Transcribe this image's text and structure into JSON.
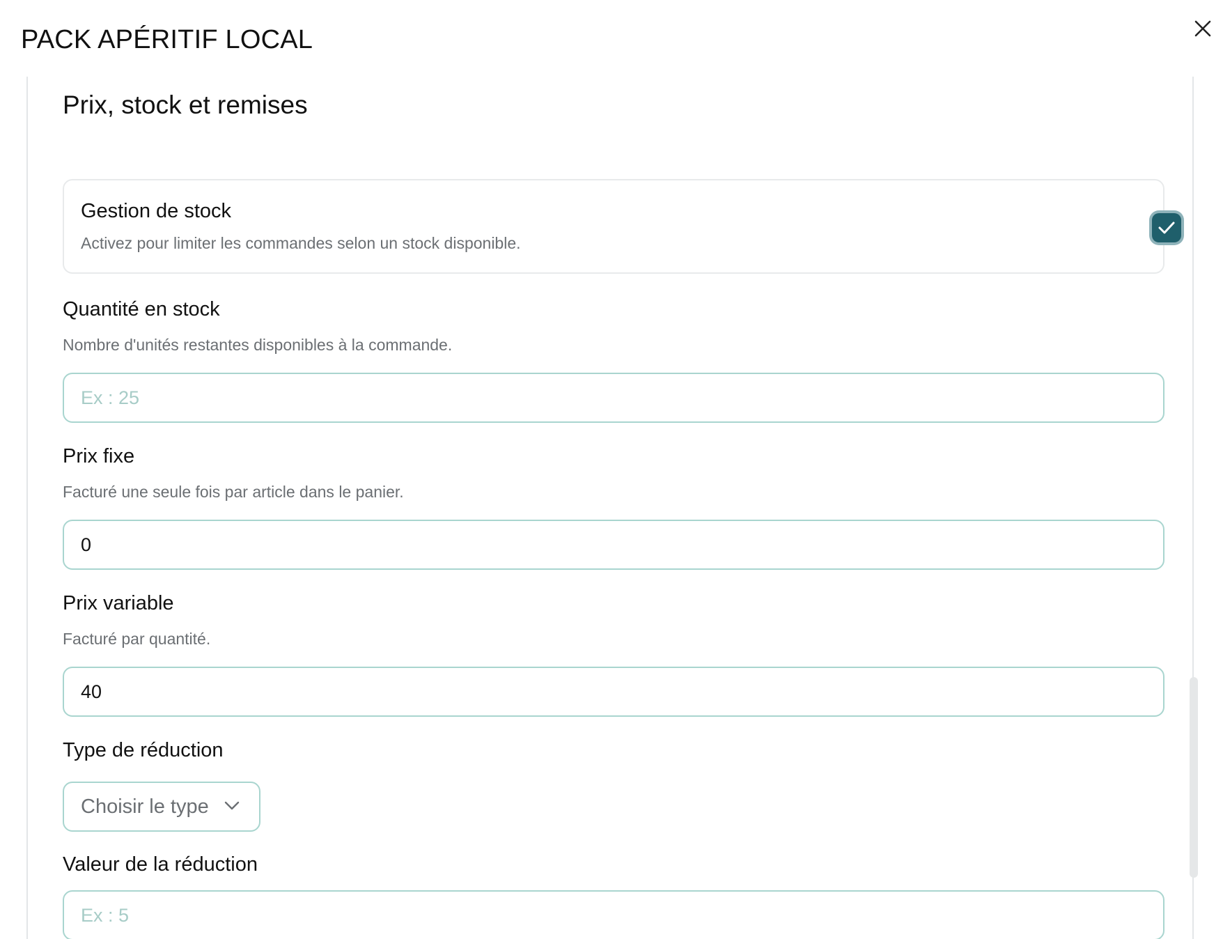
{
  "modal": {
    "title": "PACK APÉRITIF LOCAL",
    "close_icon": "close-icon"
  },
  "section": {
    "title": "Prix, stock et remises"
  },
  "stock_management": {
    "title": "Gestion de stock",
    "description": "Activez pour limiter les commandes selon un stock disponible.",
    "checked": true,
    "check_icon": "checkmark-icon",
    "accent_color": "#1f5f6b"
  },
  "quantity": {
    "label": "Quantité en stock",
    "help": "Nombre d'unités restantes disponibles à la commande.",
    "value": "",
    "placeholder": "Ex : 25"
  },
  "fixed_price": {
    "label": "Prix fixe",
    "help": "Facturé une seule fois par article dans le panier.",
    "value": "0"
  },
  "variable_price": {
    "label": "Prix variable",
    "help": "Facturé par quantité.",
    "value": "40"
  },
  "discount_type": {
    "label": "Type de réduction",
    "selected": "Choisir le type",
    "icon": "chevron-down-icon"
  },
  "discount_value": {
    "label": "Valeur de la réduction",
    "placeholder": "Ex : 5"
  },
  "colors": {
    "input_border": "#a9d5cf",
    "placeholder": "#a7ccc7",
    "muted_text": "#6b6f73"
  }
}
